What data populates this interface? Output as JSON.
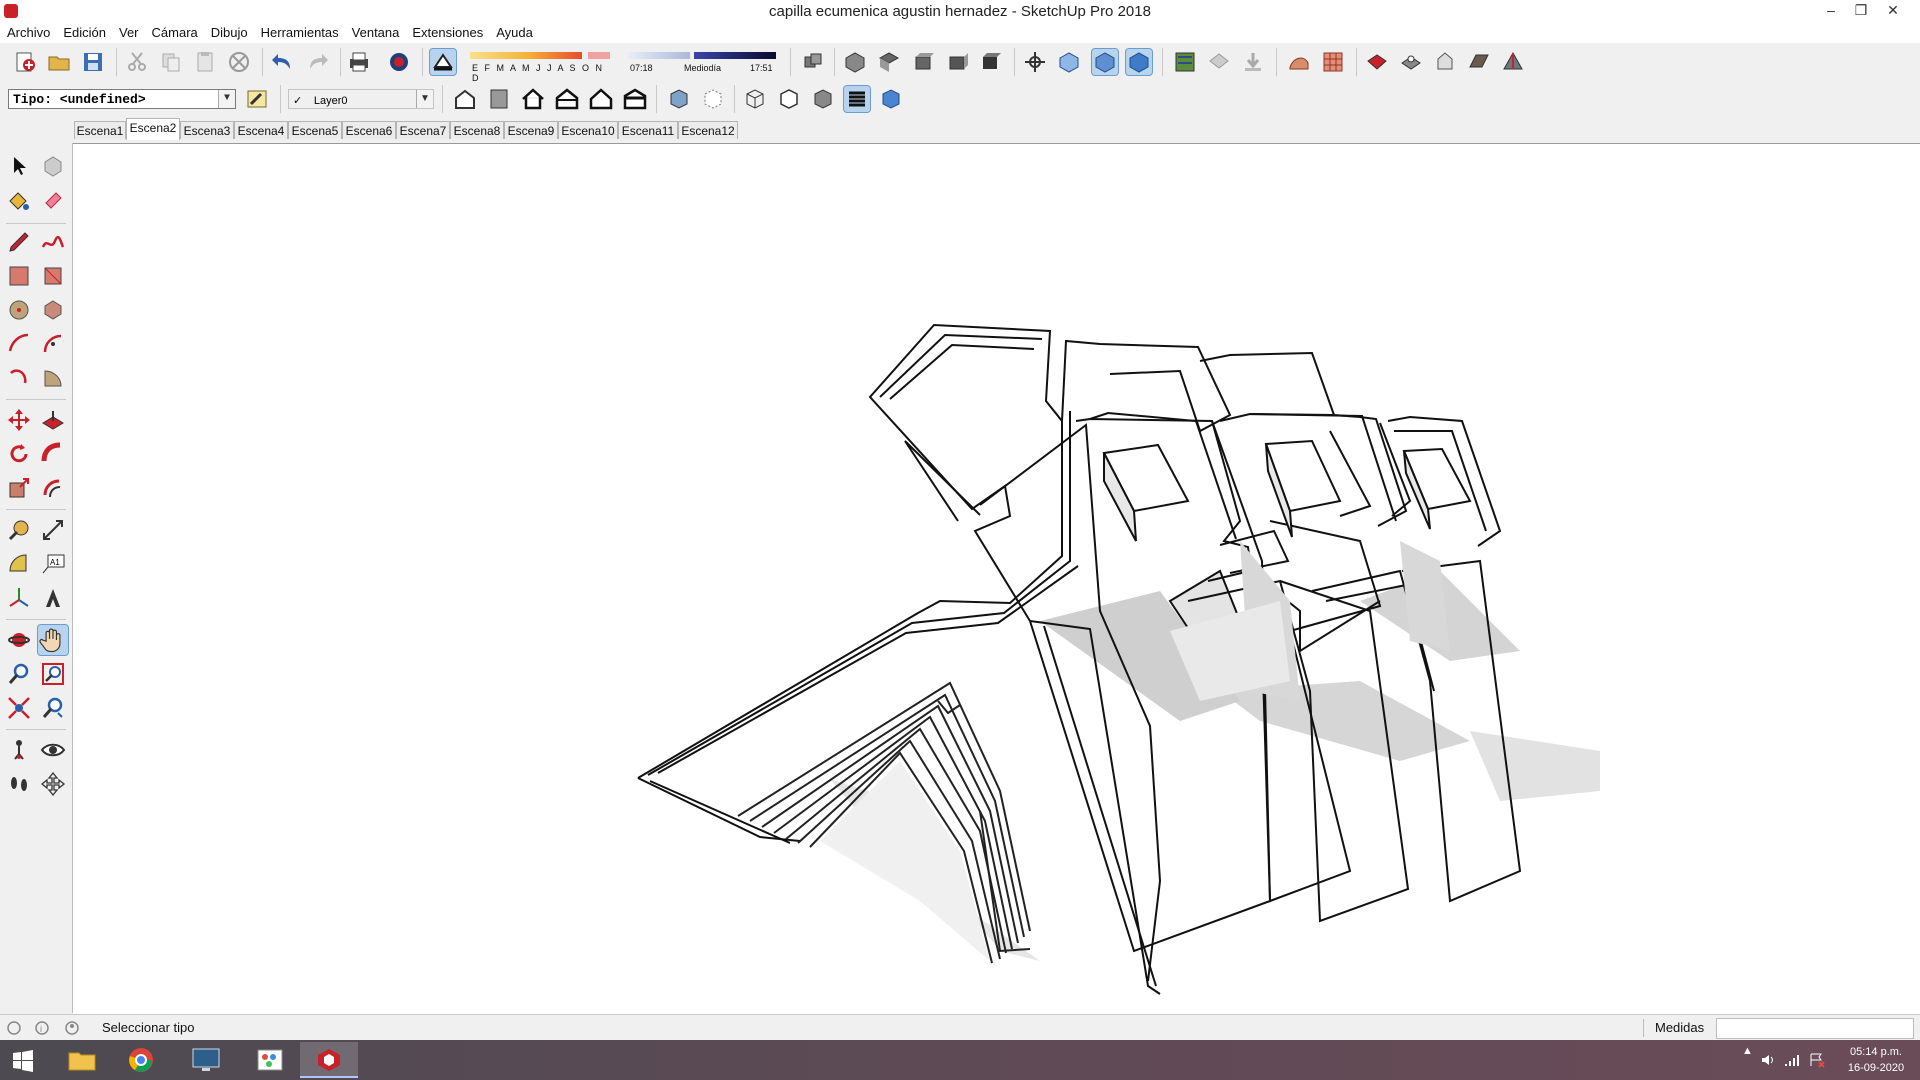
{
  "window": {
    "title": "capilla ecumenica agustin hernadez - SketchUp Pro 2018"
  },
  "menu": [
    "Archivo",
    "Edición",
    "Ver",
    "Cámara",
    "Dibujo",
    "Herramientas",
    "Ventana",
    "Extensiones",
    "Ayuda"
  ],
  "shadows": {
    "months": "E F M A M J J A S O N D",
    "start_time": "07:18",
    "mid_label": "Mediodía",
    "end_time": "17:51"
  },
  "type_selector": {
    "value": "Tipo: <undefined>"
  },
  "layer_selector": {
    "check": "✓",
    "value": "Layer0"
  },
  "scenes": [
    "Escena1",
    "Escena2",
    "Escena3",
    "Escena4",
    "Escena5",
    "Escena6",
    "Escena7",
    "Escena8",
    "Escena9",
    "Escena10",
    "Escena11",
    "Escena12"
  ],
  "active_scene": "Escena2",
  "status": {
    "message": "Seleccionar tipo",
    "measure_label": "Medidas"
  },
  "taskbar": {
    "time": "05:14 p.m.",
    "date": "16-09-2020"
  },
  "colors": {
    "accent": "#b8d3ee",
    "sketchup_red": "#c9202a",
    "taskbar": "#5e4a55"
  }
}
